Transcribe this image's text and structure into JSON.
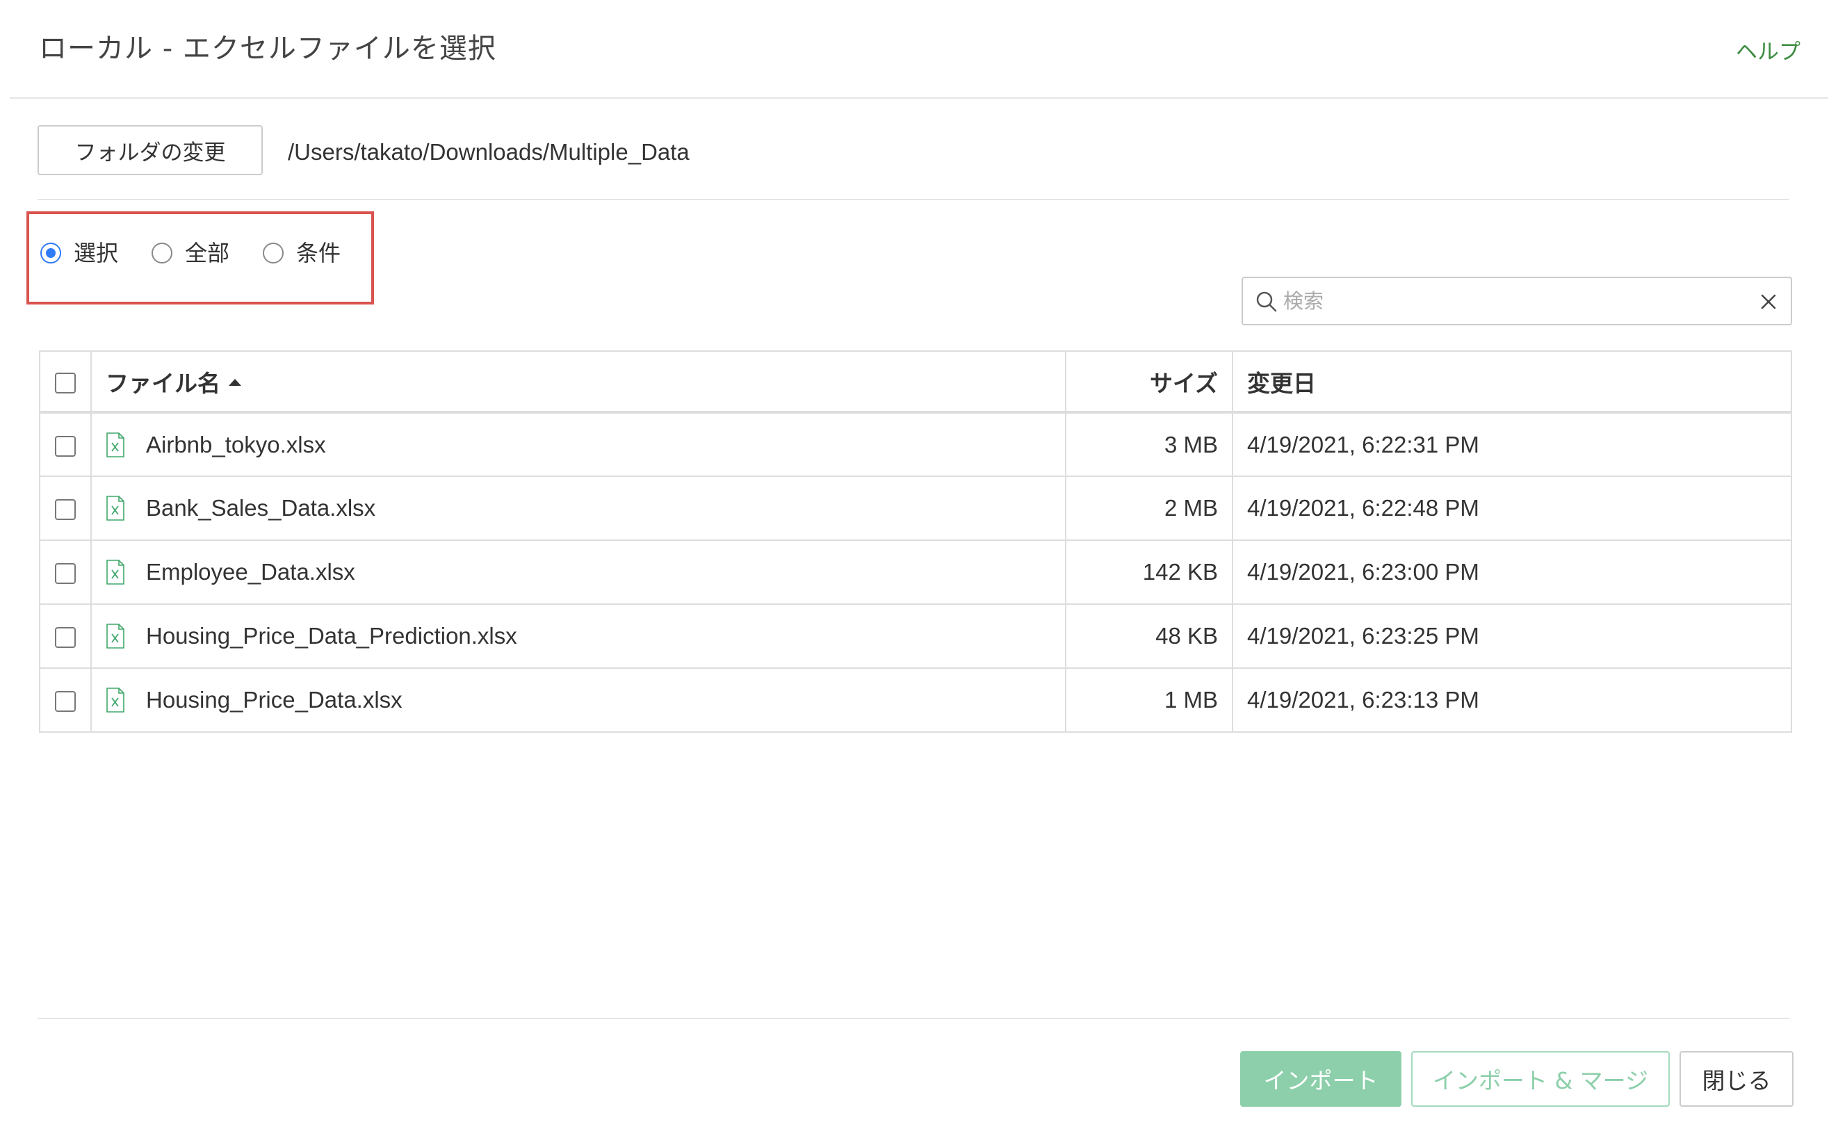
{
  "dialog": {
    "title": "ローカル - エクセルファイルを選択",
    "help_label": "ヘルプ"
  },
  "folder": {
    "change_label": "フォルダの変更",
    "path": "/Users/takato/Downloads/Multiple_Data"
  },
  "mode": {
    "options": [
      {
        "label": "選択",
        "checked": true
      },
      {
        "label": "全部",
        "checked": false
      },
      {
        "label": "条件",
        "checked": false
      }
    ],
    "highlight_color": "#d9534f"
  },
  "search": {
    "placeholder": "検索",
    "value": ""
  },
  "table": {
    "columns": {
      "name": "ファイル名",
      "size": "サイズ",
      "modified": "変更日"
    },
    "sort": {
      "column": "name",
      "direction": "ascending"
    },
    "rows": [
      {
        "name": "Airbnb_tokyo.xlsx",
        "size": "3 MB",
        "modified": "4/19/2021, 6:22:31 PM"
      },
      {
        "name": "Bank_Sales_Data.xlsx",
        "size": "2 MB",
        "modified": "4/19/2021, 6:22:48 PM"
      },
      {
        "name": "Employee_Data.xlsx",
        "size": "142 KB",
        "modified": "4/19/2021, 6:23:00 PM"
      },
      {
        "name": "Housing_Price_Data_Prediction.xlsx",
        "size": "48 KB",
        "modified": "4/19/2021, 6:23:25 PM"
      },
      {
        "name": "Housing_Price_Data.xlsx",
        "size": "1 MB",
        "modified": "4/19/2021, 6:23:13 PM"
      }
    ]
  },
  "footer": {
    "import_label": "インポート",
    "import_merge_label": "インポート & マージ",
    "close_label": "閉じる"
  },
  "colors": {
    "accent_green": "#3d8c40",
    "button_green": "#8ccfaa",
    "radio_blue": "#2f7cf6",
    "excel_icon_green": "#3fa86b"
  },
  "icons": {
    "search": "search-icon",
    "clear": "close-icon",
    "file": "excel-file-icon",
    "sort": "sort-ascending-icon"
  }
}
